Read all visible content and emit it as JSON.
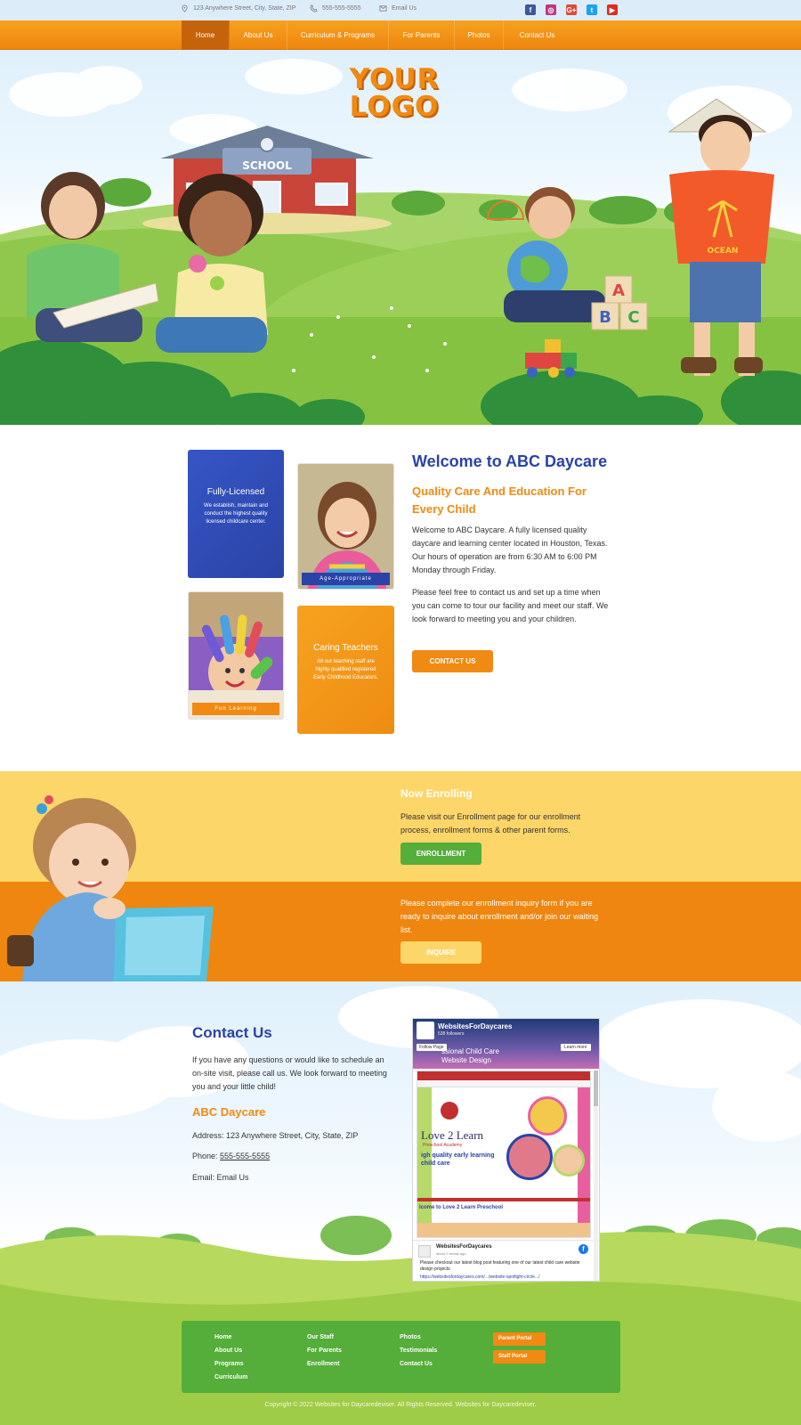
{
  "topbar": {
    "address": "123 Anywhere Street, City, State, ZIP",
    "phone": "555-555-5555",
    "email": "Email Us",
    "social": [
      {
        "icon": "facebook-icon",
        "glyph": "f",
        "color": "#3b5998"
      },
      {
        "icon": "instagram-icon",
        "glyph": "◎",
        "color": "#c13584"
      },
      {
        "icon": "google-plus-icon",
        "glyph": "G+",
        "color": "#dd4b39"
      },
      {
        "icon": "twitter-icon",
        "glyph": "t",
        "color": "#1da1f2"
      },
      {
        "icon": "youtube-icon",
        "glyph": "▶",
        "color": "#e02a20"
      }
    ]
  },
  "nav": {
    "items": [
      "Home",
      "About Us",
      "Curriculum & Programs",
      "For Parents",
      "Photos",
      "Contact Us"
    ],
    "active": "Home"
  },
  "hero": {
    "logo_line1": "YOUR",
    "logo_line2": "LOGO",
    "school_sign": "SCHOOL",
    "shirt_text": "OCEAN",
    "blocks": [
      "A",
      "B",
      "C"
    ]
  },
  "welcome": {
    "cards": {
      "licensed_title": "Fully-Licensed",
      "licensed_text": "We establish, maintain and conduct the highest quality licensed childcare center.",
      "age_caption": "Age-Appropriate",
      "fun_caption": "Fun Learning",
      "teachers_title": "Caring Teachers",
      "teachers_text": "All our teaching staff are highly qualified registered Early Childhood Educators."
    },
    "title": "Welcome to ABC Daycare",
    "subtitle": "Quality Care And Education For Every Child",
    "p1": "Welcome to ABC Daycare. A fully licensed quality daycare and learning center located in Houston, Texas. Our hours of operation are from 6:30 AM to 6:00 PM Monday through Friday.",
    "p2": "Please feel free to contact us and set up a time when you can come to tour our facility and meet our staff. We look forward to meeting you and your children.",
    "button": "CONTACT US"
  },
  "enrollment": {
    "title": "Now Enrolling",
    "p1": "Please visit our Enrollment page for our enrollment process, enrollment forms & other parent forms.",
    "button1": "ENROLLMENT",
    "p2": "Please complete our enrollment inquiry form if you are ready to inquire about enrollment and/or join our waiting list.",
    "button2": "INQUIRE"
  },
  "contact": {
    "title": "Contact Us",
    "p": "If you have any questions or would like to schedule an on-site visit, please call us. We look forward to meeting you and your little child!",
    "subtitle": "ABC Daycare",
    "address": "Address: 123 Anywhere Street, City, State, ZIP",
    "phone_label": "Phone: ",
    "phone": "555-555-5555",
    "email_label": "Email: ",
    "email": "Email Us"
  },
  "facebook": {
    "page_name": "WebsitesForDaycares",
    "followers": "538 followers",
    "follow": "Follow Page",
    "learn_more": "Learn more",
    "banner_text": "ssional Child Care",
    "banner_text2": "Website Design",
    "site_name": "Love 2 Learn",
    "site_sub": "Preschool Academy",
    "site_tagline": "igh quality early learning child care",
    "site_welcome": "lcome to Love 2 Learn Preschool",
    "post_author": "WebsitesForDaycares",
    "post_time": "about 2 weeks ago",
    "post_text": "Please checkout our latest blog post featuring one of our latest child care website design projects",
    "post_link": "https://websitesfordaycares.com/.../website-spotlight-circle.../"
  },
  "footer": {
    "col1": [
      "Home",
      "About Us",
      "Programs",
      "Curriculum"
    ],
    "col2": [
      "Our Staff",
      "For Parents",
      "Enrollment"
    ],
    "col3": [
      "Photos",
      "Testimonials",
      "Contact Us"
    ],
    "portals": [
      "Parent Portal",
      "Staff Portal"
    ],
    "copyright": "Copyright © 2022 Websites for Daycaredeviser. All Rights Reserved. Websites for Daycaredeviser."
  },
  "colors": {
    "brand_orange": "#f08a13",
    "brand_blue": "#2a43a6",
    "brand_green": "#55ad3a",
    "band_yellow": "#fdd66a"
  }
}
